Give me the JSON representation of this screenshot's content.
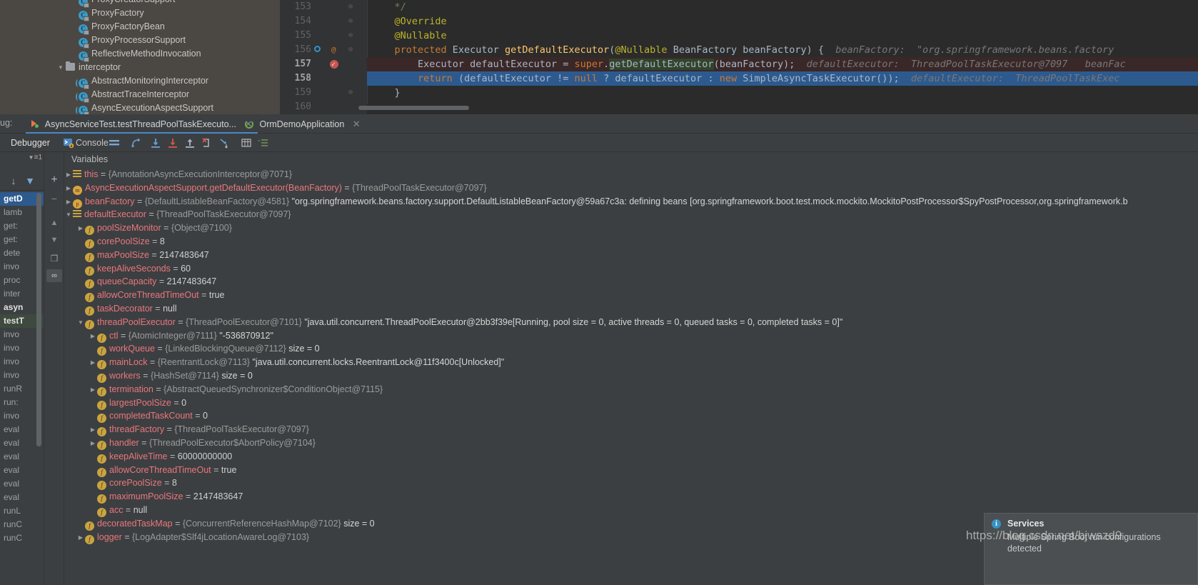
{
  "project_tree": {
    "items": [
      {
        "label": "ProxyCreatorSupport",
        "icon": "class-icon",
        "indent": 2,
        "type": "class",
        "partial": true
      },
      {
        "label": "ProxyFactory",
        "icon": "class-icon",
        "indent": 2,
        "type": "class"
      },
      {
        "label": "ProxyFactoryBean",
        "icon": "class-icon",
        "indent": 2,
        "type": "class"
      },
      {
        "label": "ProxyProcessorSupport",
        "icon": "class-icon",
        "indent": 2,
        "type": "class"
      },
      {
        "label": "ReflectiveMethodInvocation",
        "icon": "class-icon",
        "indent": 2,
        "type": "class"
      },
      {
        "label": "interceptor",
        "icon": "folder-icon",
        "indent": 1,
        "type": "folder",
        "expanded": true
      },
      {
        "label": "AbstractMonitoringInterceptor",
        "icon": "abstract-class-icon",
        "indent": 2,
        "type": "abstract"
      },
      {
        "label": "AbstractTraceInterceptor",
        "icon": "abstract-class-icon",
        "indent": 2,
        "type": "abstract"
      },
      {
        "label": "AsyncExecutionAspectSupport",
        "icon": "abstract-class-icon",
        "indent": 2,
        "type": "abstract"
      }
    ]
  },
  "editor": {
    "lines": [
      {
        "num": "153",
        "fold": "⊖",
        "segments": [
          {
            "t": "    */",
            "c": "str"
          }
        ]
      },
      {
        "num": "154",
        "fold": "⊖",
        "segments": [
          {
            "t": "    @Override",
            "c": "ann"
          }
        ]
      },
      {
        "num": "155",
        "fold": "⊖",
        "segments": [
          {
            "t": "    @Nullable",
            "c": "ann"
          }
        ]
      },
      {
        "num": "156",
        "fold": "⊖",
        "gutter_at": "@",
        "gutter_bm": true,
        "segments": [
          {
            "t": "    protected ",
            "c": "kw"
          },
          {
            "t": "Executor ",
            "c": "typ"
          },
          {
            "t": "getDefaultExecutor",
            "c": "mth"
          },
          {
            "t": "(",
            "c": "pln"
          },
          {
            "t": "@Nullable",
            "c": "ann"
          },
          {
            "t": " BeanFactory beanFactory) {",
            "c": "typ"
          }
        ],
        "hint": "beanFactory:  \"org.springframework.beans.factory"
      },
      {
        "num": "157",
        "breakpoint": true,
        "exec_highlight": true,
        "segments": [
          {
            "t": "        Executor defaultExecutor = ",
            "c": "typ"
          },
          {
            "t": "super",
            "c": "kw"
          },
          {
            "t": ".",
            "c": "pln"
          },
          {
            "t": "getDefaultExecutor",
            "c": "typ",
            "green": true
          },
          {
            "t": "(beanFactory);",
            "c": "typ"
          }
        ],
        "hint": "defaultExecutor:  ThreadPoolTaskExecutor@7097",
        "hint2": "beanFac"
      },
      {
        "num": "158",
        "current": true,
        "segments": [
          {
            "t": "        ",
            "c": "pln"
          },
          {
            "t": "return",
            "c": "kw"
          },
          {
            "t": " (defaultExecutor != ",
            "c": "typ"
          },
          {
            "t": "null",
            "c": "kw"
          },
          {
            "t": " ? defaultExecutor : ",
            "c": "typ"
          },
          {
            "t": "new",
            "c": "kw"
          },
          {
            "t": " SimpleAsyncTaskExecutor());",
            "c": "typ"
          }
        ],
        "hint": "defaultExecutor:  ThreadPoolTaskExec"
      },
      {
        "num": "159",
        "fold": "⊖",
        "segments": [
          {
            "t": "    }",
            "c": "typ"
          }
        ]
      },
      {
        "num": "160",
        "segments": [
          {
            "t": "",
            "c": "pln"
          }
        ]
      }
    ]
  },
  "debug_window": {
    "label": "ug:",
    "tabs": [
      {
        "label": "AsyncServiceTest.testThreadPoolTaskExecuto...",
        "icon": "run-test-icon",
        "active": true,
        "closable": true
      },
      {
        "label": "OrmDemoApplication",
        "icon": "spring-boot-icon",
        "active": false,
        "closable": true
      }
    ],
    "toolbar": {
      "debugger_tab": "Debugger",
      "console_tab": "Console",
      "buttons": [
        {
          "name": "layout-settings-icon",
          "glyph": "≡"
        },
        {
          "name": "step-over-icon",
          "glyph": "over"
        },
        {
          "name": "step-into-icon",
          "glyph": "into"
        },
        {
          "name": "force-step-into-icon",
          "glyph": "force"
        },
        {
          "name": "step-out-icon",
          "glyph": "out"
        },
        {
          "name": "drop-frame-icon",
          "glyph": "drop"
        },
        {
          "name": "run-to-cursor-icon",
          "glyph": "cursor"
        },
        {
          "name": "evaluate-expression-icon",
          "glyph": "⊞"
        },
        {
          "name": "show-execution-point-icon",
          "glyph": "≣"
        }
      ]
    }
  },
  "frames": {
    "header_count": "1",
    "toolbar": [
      {
        "name": "sort-frames-icon",
        "glyph": "↓"
      },
      {
        "name": "filter-frames-icon",
        "glyph": "ᐃ"
      }
    ],
    "items": [
      {
        "label": "getD",
        "selected": true
      },
      {
        "label": "lamb"
      },
      {
        "label": "get:"
      },
      {
        "label": "get:"
      },
      {
        "label": "dete"
      },
      {
        "label": "invo"
      },
      {
        "label": "proc"
      },
      {
        "label": "inter"
      },
      {
        "label": "asyn",
        "bold": true
      },
      {
        "label": "testT",
        "test": true
      },
      {
        "label": "invo"
      },
      {
        "label": "invo"
      },
      {
        "label": "invo"
      },
      {
        "label": "invo"
      },
      {
        "label": "runR"
      },
      {
        "label": "run:"
      },
      {
        "label": "invo"
      },
      {
        "label": "eval"
      },
      {
        "label": "eval"
      },
      {
        "label": "eval"
      },
      {
        "label": "eval"
      },
      {
        "label": "eval"
      },
      {
        "label": "eval"
      },
      {
        "label": "runL"
      },
      {
        "label": "runC"
      },
      {
        "label": "runC"
      }
    ]
  },
  "vars_toolbar": [
    {
      "name": "add-watch-button",
      "glyph": "+"
    },
    {
      "name": "remove-watch-button",
      "glyph": "−"
    },
    {
      "name": "move-watch-up-button",
      "glyph": "▲"
    },
    {
      "name": "move-watch-down-button",
      "glyph": "▼"
    },
    {
      "name": "copy-value-button",
      "glyph": "❐"
    },
    {
      "name": "inspect-button",
      "glyph": "∞"
    }
  ],
  "variables": {
    "title": "Variables",
    "rows": [
      {
        "indent": 0,
        "twisty": "▶",
        "icon": "lines-icon",
        "name": "this",
        "eq": " = ",
        "value": "{AnnotationAsyncExecutionInterceptor@7071}"
      },
      {
        "indent": 0,
        "twisty": "▶",
        "icon": "method-icon",
        "name": "AsyncExecutionAspectSupport.getDefaultExecutor(BeanFactory)",
        "eq": " = ",
        "value": "{ThreadPoolTaskExecutor@7097}"
      },
      {
        "indent": 0,
        "twisty": "▶",
        "icon": "param-icon",
        "name": "beanFactory",
        "eq": " = ",
        "value": "{DefaultListableBeanFactory@4581}",
        "str": "\"org.springframework.beans.factory.support.DefaultListableBeanFactory@59a67c3a: defining beans [org.springframework.boot.test.mock.mockito.MockitoPostProcessor$SpyPostProcessor,org.springframework.b"
      },
      {
        "indent": 0,
        "twisty": "▼",
        "icon": "lines-icon",
        "name": "defaultExecutor",
        "eq": " = ",
        "value": "{ThreadPoolTaskExecutor@7097}"
      },
      {
        "indent": 1,
        "twisty": "▶",
        "icon": "field-icon",
        "name": "poolSizeMonitor",
        "eq": " = ",
        "value": "{Object@7100}"
      },
      {
        "indent": 1,
        "twisty": "",
        "icon": "field-icon",
        "name": "corePoolSize",
        "eq": " = ",
        "num": "8"
      },
      {
        "indent": 1,
        "twisty": "",
        "icon": "field-icon",
        "name": "maxPoolSize",
        "eq": " = ",
        "num": "2147483647"
      },
      {
        "indent": 1,
        "twisty": "",
        "icon": "field-icon",
        "name": "keepAliveSeconds",
        "eq": " = ",
        "num": "60"
      },
      {
        "indent": 1,
        "twisty": "",
        "icon": "field-icon",
        "name": "queueCapacity",
        "eq": " = ",
        "num": "2147483647"
      },
      {
        "indent": 1,
        "twisty": "",
        "icon": "field-icon",
        "name": "allowCoreThreadTimeOut",
        "eq": " = ",
        "num": "true"
      },
      {
        "indent": 1,
        "twisty": "",
        "icon": "field-icon",
        "name": "taskDecorator",
        "eq": " = ",
        "num": "null"
      },
      {
        "indent": 1,
        "twisty": "▼",
        "icon": "field-icon",
        "name": "threadPoolExecutor",
        "eq": " = ",
        "value": "{ThreadPoolExecutor@7101}",
        "str": "\"java.util.concurrent.ThreadPoolExecutor@2bb3f39e[Running, pool size = 0, active threads = 0, queued tasks = 0, completed tasks = 0]\""
      },
      {
        "indent": 2,
        "twisty": "▶",
        "icon": "field-icon",
        "name": "ctl",
        "eq": " = ",
        "value": "{AtomicInteger@7111}",
        "str": "\"-536870912\""
      },
      {
        "indent": 2,
        "twisty": "",
        "icon": "field-icon",
        "name": "workQueue",
        "eq": " = ",
        "value": "{LinkedBlockingQueue@7112}",
        "str": " size = 0"
      },
      {
        "indent": 2,
        "twisty": "▶",
        "icon": "field-icon",
        "name": "mainLock",
        "eq": " = ",
        "value": "{ReentrantLock@7113}",
        "str": "\"java.util.concurrent.locks.ReentrantLock@11f3400c[Unlocked]\""
      },
      {
        "indent": 2,
        "twisty": "",
        "icon": "field-icon",
        "name": "workers",
        "eq": " = ",
        "value": "{HashSet@7114}",
        "str": " size = 0"
      },
      {
        "indent": 2,
        "twisty": "▶",
        "icon": "field-icon",
        "name": "termination",
        "eq": " = ",
        "value": "{AbstractQueuedSynchronizer$ConditionObject@7115}"
      },
      {
        "indent": 2,
        "twisty": "",
        "icon": "field-icon",
        "name": "largestPoolSize",
        "eq": " = ",
        "num": "0"
      },
      {
        "indent": 2,
        "twisty": "",
        "icon": "field-icon",
        "name": "completedTaskCount",
        "eq": " = ",
        "num": "0"
      },
      {
        "indent": 2,
        "twisty": "▶",
        "icon": "field-icon",
        "name": "threadFactory",
        "eq": " = ",
        "value": "{ThreadPoolTaskExecutor@7097}"
      },
      {
        "indent": 2,
        "twisty": "▶",
        "icon": "field-icon",
        "name": "handler",
        "eq": " = ",
        "value": "{ThreadPoolExecutor$AbortPolicy@7104}"
      },
      {
        "indent": 2,
        "twisty": "",
        "icon": "field-icon",
        "name": "keepAliveTime",
        "eq": " = ",
        "num": "60000000000"
      },
      {
        "indent": 2,
        "twisty": "",
        "icon": "field-icon",
        "name": "allowCoreThreadTimeOut",
        "eq": " = ",
        "num": "true"
      },
      {
        "indent": 2,
        "twisty": "",
        "icon": "field-icon",
        "name": "corePoolSize",
        "eq": " = ",
        "num": "8"
      },
      {
        "indent": 2,
        "twisty": "",
        "icon": "field-icon",
        "name": "maximumPoolSize",
        "eq": " = ",
        "num": "2147483647"
      },
      {
        "indent": 2,
        "twisty": "",
        "icon": "field-icon",
        "name": "acc",
        "eq": " = ",
        "num": "null"
      },
      {
        "indent": 1,
        "twisty": "",
        "icon": "field-icon",
        "name": "decoratedTaskMap",
        "eq": " = ",
        "value": "{ConcurrentReferenceHashMap@7102}",
        "str": " size = 0"
      },
      {
        "indent": 1,
        "twisty": "▶",
        "icon": "field-icon",
        "name": "logger",
        "eq": " = ",
        "value": "{LogAdapter$Slf4jLocationAwareLog@7103}"
      }
    ]
  },
  "services_balloon": {
    "title": "Services",
    "message": "Multiple Spring Boot run configurations detected"
  },
  "watermark": "https://blog.csdn.net/bjwszd9",
  "colors": {
    "accent_blue": "#4a88c7",
    "selection_blue": "#2d5a8e",
    "editor_bg": "#2b2b2b",
    "panel_bg": "#3c3f41",
    "var_name": "#e8777e",
    "keyword": "#cc7832",
    "annotation": "#bbb529",
    "method": "#ffc66d",
    "string": "#6a8759",
    "breakpoint": "#c75450"
  }
}
